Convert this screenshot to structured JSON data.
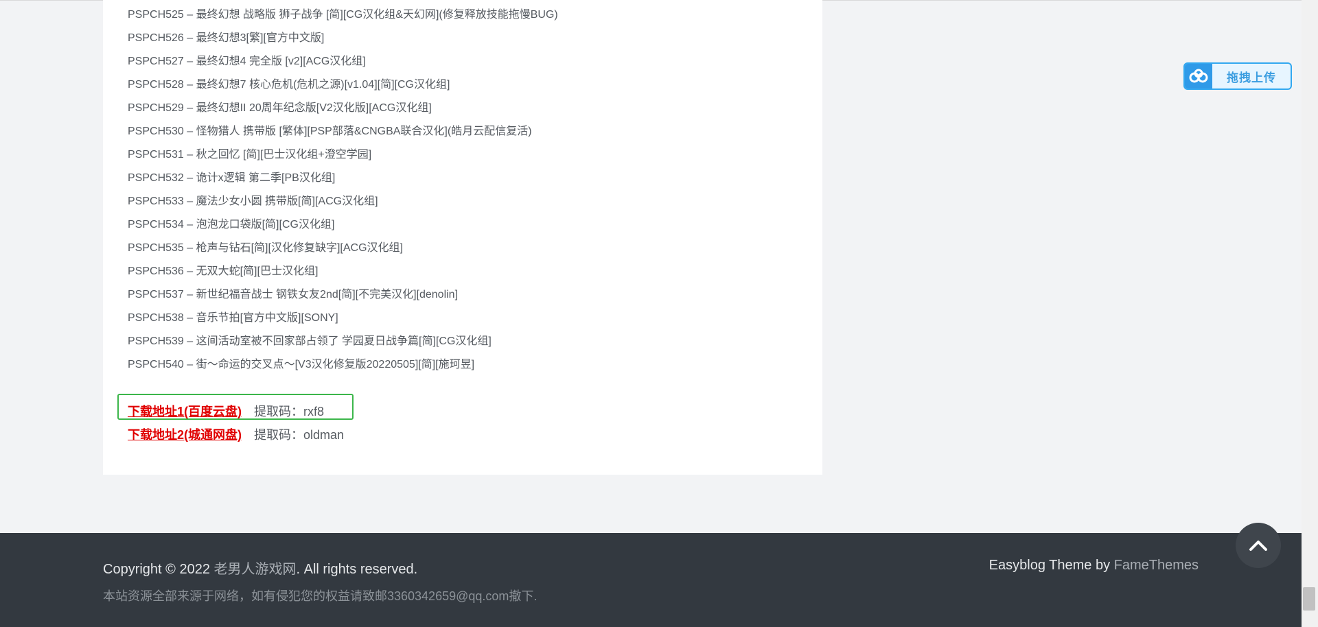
{
  "games": [
    "PSPCH525 – 最终幻想 战略版 狮子战争 [简][CG汉化组&天幻网](修复释放技能拖慢BUG)",
    "PSPCH526 – 最终幻想3[繁][官方中文版]",
    "PSPCH527 – 最终幻想4 完全版 [v2][ACG汉化组]",
    "PSPCH528 – 最终幻想7 核心危机(危机之源)[v1.04][简][CG汉化组]",
    "PSPCH529 – 最终幻想II 20周年纪念版[V2汉化版][ACG汉化组]",
    "PSPCH530 – 怪物猎人 携带版 [繁体][PSP部落&CNGBA联合汉化](皓月云配信复活)",
    "PSPCH531 – 秋之回忆 [简][巴士汉化组+澄空学园]",
    "PSPCH532 – 诡计x逻辑 第二季[PB汉化组]",
    "PSPCH533 – 魔法少女小圆 携带版[简][ACG汉化组]",
    "PSPCH534 – 泡泡龙口袋版[简][CG汉化组]",
    "PSPCH535 – 枪声与钻石[简][汉化修复缺字][ACG汉化组]",
    "PSPCH536 – 无双大蛇[简][巴士汉化组]",
    "PSPCH537 – 新世纪福音战士 钢铁女友2nd[简][不完美汉化][denolin]",
    "PSPCH538 – 音乐节拍[官方中文版][SONY]",
    "PSPCH539 – 这间活动室被不回家部占领了 学园夏日战争篇[简][CG汉化组]",
    "PSPCH540 – 街～命运的交叉点～[V3汉化修复版20220505][简][施珂昱]"
  ],
  "downloads": {
    "link1": "下载地址1(百度云盘)",
    "code1": "提取码：rxf8",
    "link2": "下载地址2(城通网盘)",
    "code2": "提取码：oldman"
  },
  "upload_widget": {
    "label": "拖拽上传",
    "icon": "baidu-cloud-icon"
  },
  "footer": {
    "copyright_prefix": "Copyright © 2022 ",
    "site_name": "老男人游戏网",
    "copyright_suffix": ". All rights reserved.",
    "disclaimer": "本站资源全部来源于网络，如有侵犯您的权益请致邮3360342659@qq.com撤下.",
    "theme_prefix": "Easyblog Theme by ",
    "theme_author": "FameThemes"
  },
  "back_to_top": {
    "icon": "chevron-up-icon"
  },
  "colors": {
    "download_link": "#e00000",
    "highlight_border": "#3cb64a",
    "footer_bg": "#333940"
  }
}
